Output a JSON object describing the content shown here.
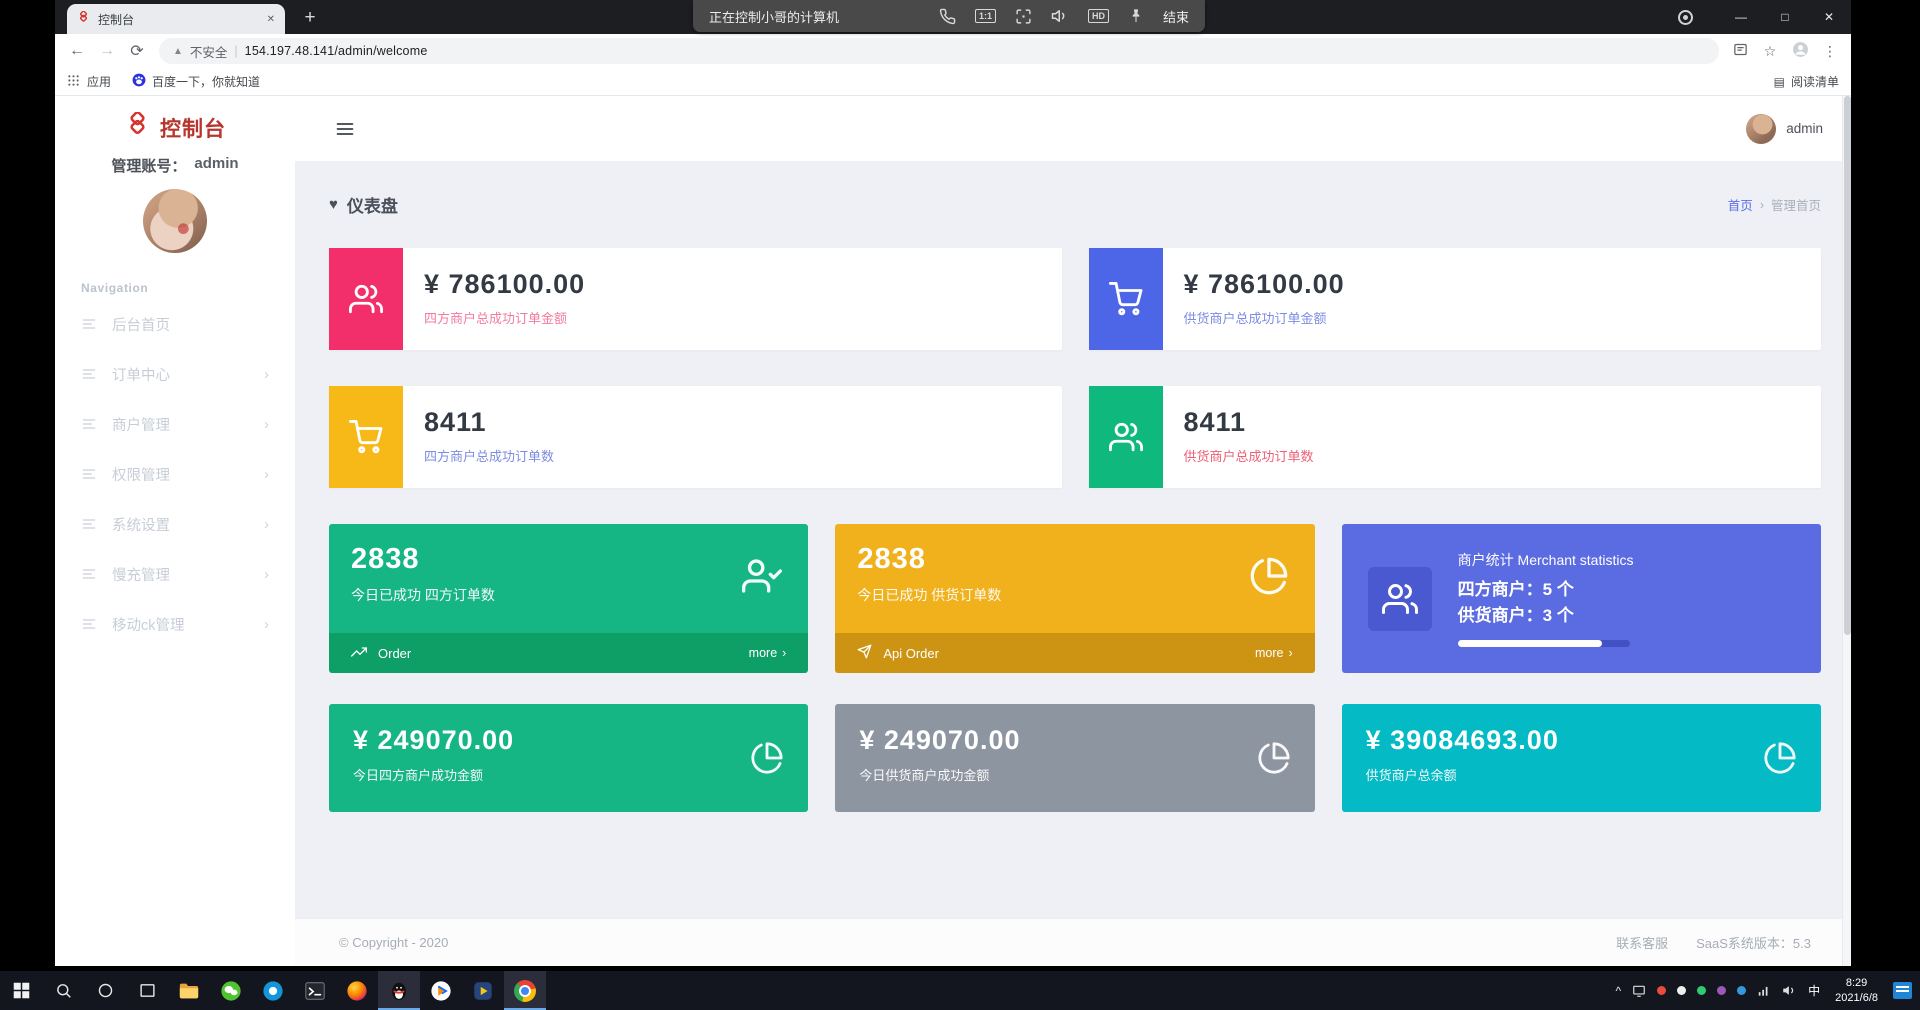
{
  "colors": {
    "accent_pink": "#f22e6b",
    "accent_blue": "#4d66e8",
    "accent_yellow": "#f6b917",
    "accent_green": "#0fb97d",
    "card_green": "#16b584",
    "card_green_footer": "#0e9f66",
    "card_yellow": "#f0b11c",
    "card_yellow_footer": "#cd9414",
    "card_blue": "#5b6ce2",
    "card_gray": "#8d95a1",
    "card_teal": "#04bac4",
    "page_background": "#eef0f5",
    "link_blue": "#5a6fe4",
    "logo_red": "#b8352e"
  },
  "glyphs": {
    "back": "←",
    "forward": "→",
    "reload": "⟳",
    "warning": "▲",
    "pipe": "|",
    "star": "☆",
    "kebab": "⋮",
    "new_tab": "+",
    "tab_close": "✕",
    "minimize": "—",
    "maximize": "□",
    "close": "✕",
    "heart": "♥",
    "chevron": "›",
    "reading_list": "▤",
    "caret": "^"
  },
  "remote_bar": {
    "title": "正在控制小哥的计算机",
    "scale_label": "1:1",
    "hd_label": "HD",
    "end_label": "结束"
  },
  "browser": {
    "tab_title": "控制台",
    "security_label": "不安全",
    "url": "154.197.48.141/admin/welcome",
    "apps_label": "应用",
    "baidu_bookmark": "百度一下，你就知道",
    "reading_list_label": "阅读清单"
  },
  "sidebar": {
    "logo_text": "控制台",
    "account_label": "管理账号：",
    "account_name": "admin",
    "nav_section_label": "Navigation",
    "items": [
      {
        "label": "后台首页",
        "has_arrow": false
      },
      {
        "label": "订单中心",
        "has_arrow": true
      },
      {
        "label": "商户管理",
        "has_arrow": true
      },
      {
        "label": "权限管理",
        "has_arrow": true
      },
      {
        "label": "系统设置",
        "has_arrow": true
      },
      {
        "label": "慢充管理",
        "has_arrow": true
      },
      {
        "label": "移动ck管理",
        "has_arrow": true
      }
    ]
  },
  "topbar": {
    "user_name": "admin"
  },
  "dashboard": {
    "title": "仪表盘",
    "breadcrumb": {
      "home": "首页",
      "current": "管理首页"
    },
    "stat_cards": [
      {
        "icon": "users-icon",
        "value": "¥ 786100.00",
        "label": "四方商户总成功订单金额"
      },
      {
        "icon": "cart-icon",
        "value": "¥ 786100.00",
        "label": "供货商户总成功订单金额"
      },
      {
        "icon": "cart-icon",
        "value": "8411",
        "label": "四方商户总成功订单数"
      },
      {
        "icon": "users-icon",
        "value": "8411",
        "label": "供货商户总成功订单数"
      }
    ],
    "action_cards": [
      {
        "icon": "user-check-icon",
        "value": "2838",
        "label": "今日已成功 四方订单数",
        "footer_icon": "trending-up-icon",
        "footer_label": "Order",
        "more_label": "more"
      },
      {
        "icon": "pie-chart-icon",
        "value": "2838",
        "label": "今日已成功 供货订单数",
        "footer_icon": "send-icon",
        "footer_label": "Api Order",
        "more_label": "more"
      }
    ],
    "merchant_card": {
      "icon": "users-icon",
      "title": "商户统计 Merchant statistics",
      "line1": "四方商户：5 个",
      "line2": "供货商户：3 个",
      "progress_percent": 84
    },
    "money_cards": [
      {
        "value": "¥ 249070.00",
        "label": "今日四方商户成功金额",
        "icon": "pie-chart-icon"
      },
      {
        "value": "¥ 249070.00",
        "label": "今日供货商户成功金额",
        "icon": "pie-chart-icon"
      },
      {
        "value": "¥ 39084693.00",
        "label": "供货商户总余额",
        "icon": "pie-chart-icon"
      }
    ],
    "footer": {
      "copyright": "© Copyright - 2020",
      "support_link": "联系客服",
      "version": "SaaS系统版本：5.3"
    }
  },
  "taskbar": {
    "time": "8:29",
    "date": "2021/6/8",
    "language": "中"
  }
}
